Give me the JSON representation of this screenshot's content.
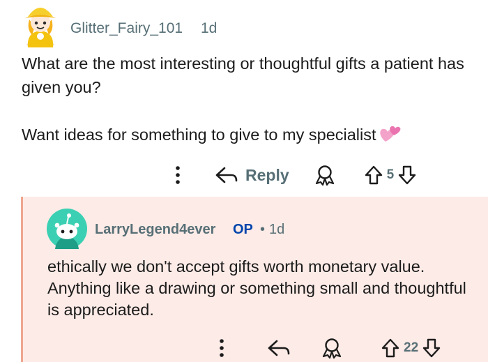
{
  "post": {
    "username": "Glitter_Fairy_101",
    "age": "1d",
    "body_lines": [
      "What are the most interesting or thoughtful gifts a patient has given you?",
      "Want ideas for something to give to my specialist"
    ],
    "emoji": "two-hearts",
    "actions": {
      "more_icon": "more-vertical-icon",
      "reply_label": "Reply",
      "award_icon": "award-icon",
      "vote_count": "5"
    }
  },
  "reply": {
    "username": "LarryLegend4ever",
    "op_badge": "OP",
    "separator": "•",
    "age": "1d",
    "body": "ethically we don't accept gifts worth monetary value. Anything like a drawing or something small and thoughtful is appreciated.",
    "accent_border": "#f0a58f",
    "background": "#fdebe7",
    "actions": {
      "more_icon": "more-vertical-icon",
      "reply_icon": "reply-icon",
      "award_icon": "award-icon",
      "vote_count": "22"
    }
  },
  "colors": {
    "meta_text": "#576f76",
    "op_badge": "#0045ac",
    "body_text": "#1c1c1c"
  }
}
